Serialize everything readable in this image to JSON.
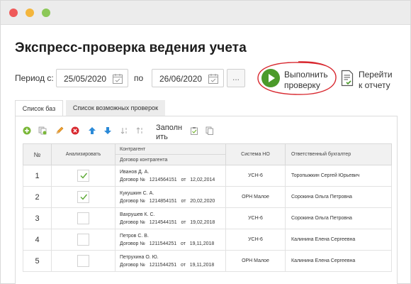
{
  "page": {
    "title": "Экспресс-проверка ведения учета"
  },
  "period": {
    "label": "Период с:",
    "from": "25/05/2020",
    "to_label": "по",
    "to": "26/06/2020",
    "ellipsis": "..."
  },
  "actions": {
    "run": {
      "line1": "Выполнить",
      "line2": "проверку"
    },
    "report": {
      "line1": "Перейти",
      "line2": "к отчету"
    }
  },
  "tabs": [
    {
      "label": "Список баз",
      "active": true
    },
    {
      "label": "Список возможных проверок",
      "active": false
    }
  ],
  "toolbar": {
    "fill_line1": "Заполн",
    "fill_line2": "ить",
    "icons": [
      "add-icon",
      "copy-icon",
      "edit-icon",
      "delete-icon",
      "move-up-icon",
      "move-down-icon",
      "sort-asc-icon",
      "sort-desc-icon",
      "paste-icon",
      "document-icon"
    ]
  },
  "table": {
    "headers": {
      "num": "№",
      "analyze": "Анализировать",
      "contragent": "Контрагент",
      "contract": "Договор контрагента",
      "tax_system": "Система НО",
      "accountant": "Ответственный бухгалтер"
    },
    "rows": [
      {
        "num": "1",
        "checked": true,
        "contragent": "Иванов Д. А.",
        "contract": "Договор №   1214564151   от   12,02,2014",
        "tax_system": "УСН-6",
        "accountant": "Торопыжкин Сергей Юрьевич"
      },
      {
        "num": "2",
        "checked": true,
        "contragent": "Кукушкин С. А.",
        "contract": "Договор №   1214854151   от   20,02,2020",
        "tax_system": "ОРН Малое",
        "accountant": "Сорокина Ольга Петровна"
      },
      {
        "num": "3",
        "checked": false,
        "contragent": "Вахрушев К. С.",
        "contract": "Договор №   1214544151   от   19,02,2018",
        "tax_system": "УСН-6",
        "accountant": "Сорокина Ольга Петровна"
      },
      {
        "num": "4",
        "checked": false,
        "contragent": "Петров С. В.",
        "contract": "Договор №   1211544251   от   19,11,2018",
        "tax_system": "УСН-6",
        "accountant": "Калинина Елена Сергеевна"
      },
      {
        "num": "5",
        "checked": false,
        "contragent": "Петрухина О. Ю.",
        "contract": "Договор №   1211544251   от   19,11,2018",
        "tax_system": "ОРН Малое",
        "accountant": "Калинина Елена Сергеевна"
      }
    ]
  },
  "colors": {
    "accent_green": "#4b9a2a",
    "highlight_red": "#d8282f",
    "header_bg": "#f1f1f1"
  }
}
